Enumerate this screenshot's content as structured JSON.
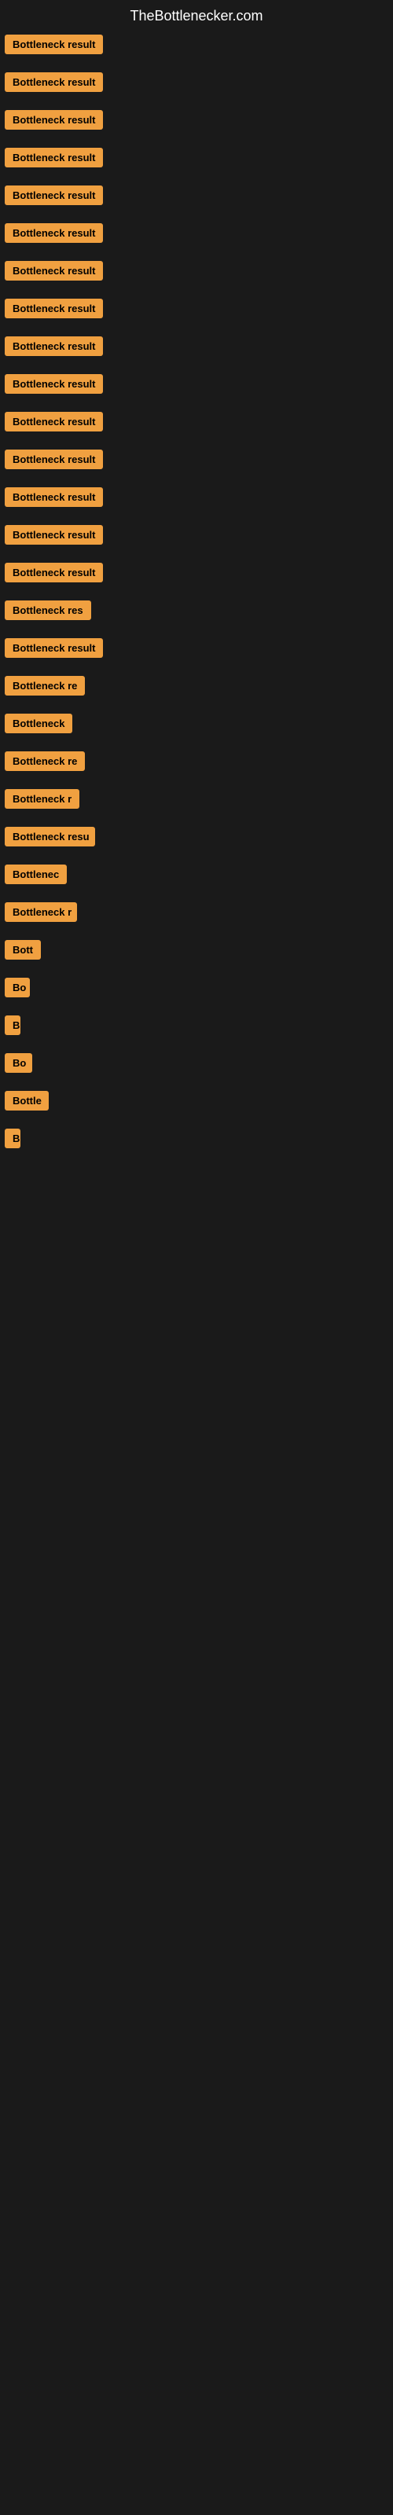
{
  "header": {
    "title": "TheBottlenecker.com"
  },
  "items": [
    {
      "label": "Bottleneck result",
      "width": 150
    },
    {
      "label": "Bottleneck result",
      "width": 150
    },
    {
      "label": "Bottleneck result",
      "width": 150
    },
    {
      "label": "Bottleneck result",
      "width": 150
    },
    {
      "label": "Bottleneck result",
      "width": 150
    },
    {
      "label": "Bottleneck result",
      "width": 150
    },
    {
      "label": "Bottleneck result",
      "width": 150
    },
    {
      "label": "Bottleneck result",
      "width": 150
    },
    {
      "label": "Bottleneck result",
      "width": 150
    },
    {
      "label": "Bottleneck result",
      "width": 150
    },
    {
      "label": "Bottleneck result",
      "width": 150
    },
    {
      "label": "Bottleneck result",
      "width": 150
    },
    {
      "label": "Bottleneck result",
      "width": 150
    },
    {
      "label": "Bottleneck result",
      "width": 150
    },
    {
      "label": "Bottleneck result",
      "width": 150
    },
    {
      "label": "Bottleneck res",
      "width": 120
    },
    {
      "label": "Bottleneck result",
      "width": 140
    },
    {
      "label": "Bottleneck re",
      "width": 105
    },
    {
      "label": "Bottleneck",
      "width": 88
    },
    {
      "label": "Bottleneck re",
      "width": 105
    },
    {
      "label": "Bottleneck r",
      "width": 95
    },
    {
      "label": "Bottleneck resu",
      "width": 115
    },
    {
      "label": "Bottlenec",
      "width": 82
    },
    {
      "label": "Bottleneck r",
      "width": 92
    },
    {
      "label": "Bott",
      "width": 48
    },
    {
      "label": "Bo",
      "width": 32
    },
    {
      "label": "B",
      "width": 18
    },
    {
      "label": "Bo",
      "width": 35
    },
    {
      "label": "Bottle",
      "width": 56
    },
    {
      "label": "B",
      "width": 10
    }
  ]
}
